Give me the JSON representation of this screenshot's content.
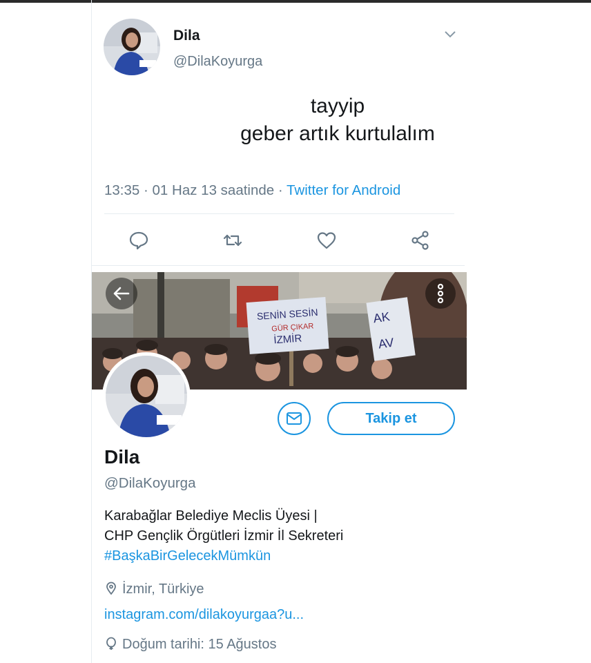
{
  "tweet": {
    "name": "Dila",
    "handle": "@DilaKoyurga",
    "text_line1": "tayyip",
    "text_line2": "geber artık kurtulalım",
    "time": "13:35 · 01 Haz 13 saatinde · ",
    "source": "Twitter for Android"
  },
  "actions": [
    "reply-icon",
    "retweet-icon",
    "like-icon",
    "share-icon"
  ],
  "profile": {
    "name": "Dila",
    "handle": "@DilaKoyurga",
    "follow_label": "Takip et",
    "bio_line1": "Karabağlar Belediye Meclis Üyesi |",
    "bio_line2": "CHP Gençlik Örgütleri İzmir İl Sekreteri",
    "bio_hashtag": "#BaşkaBirGelecekMümkün",
    "location": "İzmir, Türkiye",
    "website": "instagram.com/dilakoyurgaa?u...",
    "birthday": "Doğum tarihi: 15 Ağustos"
  },
  "banner": {
    "sign1_line1": "SENİN SESİN",
    "sign1_line2": "GÜR ÇIKAR",
    "sign1_line3": "İZMİR",
    "sign2_line1": "AK",
    "sign2_line2": "AV"
  },
  "colors": {
    "accent": "#1b95e0",
    "muted": "#657786",
    "text": "#14171a"
  }
}
